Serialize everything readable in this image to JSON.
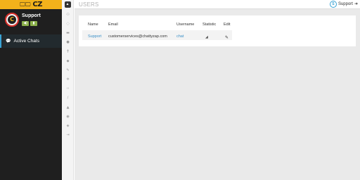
{
  "brand": {
    "logo_text": "CZ",
    "logo_icons": "🖵🖵"
  },
  "profile": {
    "name": "Support",
    "avatar_glyph": "C",
    "buttons": [
      "◀)",
      "▮"
    ]
  },
  "sidebar": {
    "active_item": {
      "label": "Active Chats",
      "icon": "chat-icon"
    }
  },
  "rail": {
    "icons": [
      {
        "name": "users-icon",
        "glyph": "⚇"
      },
      {
        "name": "comments-icon",
        "glyph": "◌"
      },
      {
        "name": "comment-icon",
        "glyph": "▬"
      },
      {
        "name": "chat-bubble-icon",
        "glyph": "●"
      },
      {
        "name": "mic-icon",
        "glyph": "ǂ"
      },
      {
        "name": "tag-icon",
        "glyph": "◆"
      },
      {
        "name": "pencil-icon",
        "glyph": "✎"
      },
      {
        "name": "gear-icon",
        "glyph": "✲"
      },
      {
        "name": "code-icon",
        "glyph": "‹›"
      },
      {
        "name": "brush-icon",
        "glyph": "∕"
      },
      {
        "name": "image-icon",
        "glyph": "▲"
      },
      {
        "name": "user-icon",
        "glyph": "◉"
      },
      {
        "name": "bookmark-icon",
        "glyph": "◈"
      },
      {
        "name": "logout-icon",
        "glyph": "⇥"
      }
    ]
  },
  "header": {
    "title": "USERS",
    "support_label": "Support",
    "arrow_glyph": "➜"
  },
  "table": {
    "columns": [
      "Name",
      "Email",
      "Username",
      "Statistic",
      "Edit"
    ],
    "rows": [
      {
        "name": "Support",
        "email": "customerservices@chattyzap.com",
        "username": "chat",
        "statistic_icon": "◢",
        "edit_icon": "✎"
      }
    ]
  },
  "colors": {
    "accent": "#f2b21b",
    "sidebar_bg": "#1f1f1f",
    "link": "#3a8fc7",
    "active_border": "#3aa3d4",
    "avatar_ring": "#d9302a",
    "button_green": "#8ab04a"
  }
}
